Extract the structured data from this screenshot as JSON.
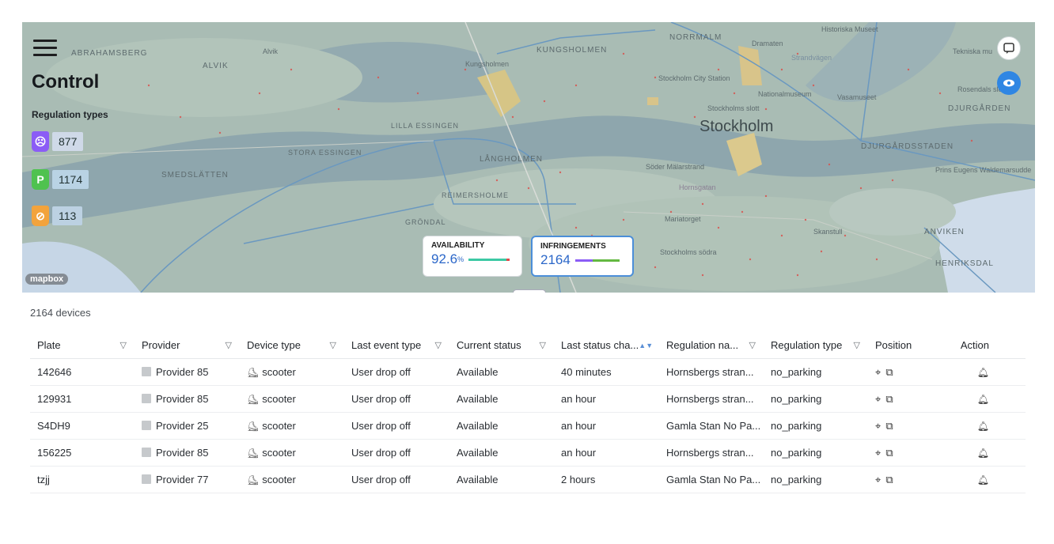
{
  "app": {
    "title": "Control"
  },
  "map": {
    "place_labels": [
      "ABRAHAMSBERG",
      "Alvik",
      "ALVIK",
      "Kungsholmen",
      "KUNGSHOLMEN",
      "NORRMALM",
      "Dramaten",
      "Historiska Museet",
      "Strandvägen",
      "Tekniska mu",
      "Stockholm City Station",
      "Nationalmuseum",
      "Vasamuseet",
      "Rosendals slo",
      "Stockholms slott",
      "Stockholm",
      "DJURGÅRDEN",
      "LILLA ESSINGEN",
      "STORA ESSINGEN",
      "SMEDSLÄTTEN",
      "LÅNGHOLMEN",
      "Söder Mälarstrand",
      "DJURGÅRDSSTADEN",
      "Hornsgatan",
      "REIMERSHOLME",
      "Prins Eugens Waldemarsudde",
      "GRÖNDAL",
      "Mariatorget",
      "Stockholms södra",
      "Skanstull",
      "ANVIKEN",
      "HENRIKSDAL"
    ],
    "attribution": "mapbox",
    "regulation_title": "Regulation types",
    "regulations": [
      {
        "icon": "no-riding-zone-icon",
        "count": "877",
        "color": "#8b5cf6",
        "badge_bg": "#cfd9e8"
      },
      {
        "icon": "parking-zone-icon",
        "count": "1174",
        "color": "#4fc24f",
        "badge_bg": "#b9d3e4"
      },
      {
        "icon": "no-parking-icon",
        "count": "113",
        "color": "#f2a33c",
        "badge_bg": "#bcd1e2"
      }
    ]
  },
  "stats": {
    "availability": {
      "label": "AVAILABILITY",
      "value": "92.6",
      "unit": "%",
      "fraction": 0.926
    },
    "infringements": {
      "label": "INFRINGEMENTS",
      "value": "2164"
    }
  },
  "table": {
    "device_count": "2164 devices",
    "columns": [
      "Plate",
      "Provider",
      "Device type",
      "Last event type",
      "Current status",
      "Last status cha...",
      "Regulation na...",
      "Regulation type",
      "Position",
      "Action"
    ],
    "rows": [
      {
        "plate": "142646",
        "provider": "Provider 85",
        "device_type": "scooter",
        "last_event": "User drop off",
        "status": "Available",
        "last_change": "40 minutes",
        "regulation_name": "Hornsbergs stran...",
        "regulation_type": "no_parking"
      },
      {
        "plate": "129931",
        "provider": "Provider 85",
        "device_type": "scooter",
        "last_event": "User drop off",
        "status": "Available",
        "last_change": "an hour",
        "regulation_name": "Hornsbergs stran...",
        "regulation_type": "no_parking"
      },
      {
        "plate": "S4DH9",
        "provider": "Provider 25",
        "device_type": "scooter",
        "last_event": "User drop off",
        "status": "Available",
        "last_change": "an hour",
        "regulation_name": "Gamla Stan No Pa...",
        "regulation_type": "no_parking"
      },
      {
        "plate": "156225",
        "provider": "Provider 85",
        "device_type": "scooter",
        "last_event": "User drop off",
        "status": "Available",
        "last_change": "an hour",
        "regulation_name": "Hornsbergs stran...",
        "regulation_type": "no_parking"
      },
      {
        "plate": "tzjj",
        "provider": "Provider 77",
        "device_type": "scooter",
        "last_event": "User drop off",
        "status": "Available",
        "last_change": "2 hours",
        "regulation_name": "Gamla Stan No Pa...",
        "regulation_type": "no_parking"
      }
    ]
  }
}
